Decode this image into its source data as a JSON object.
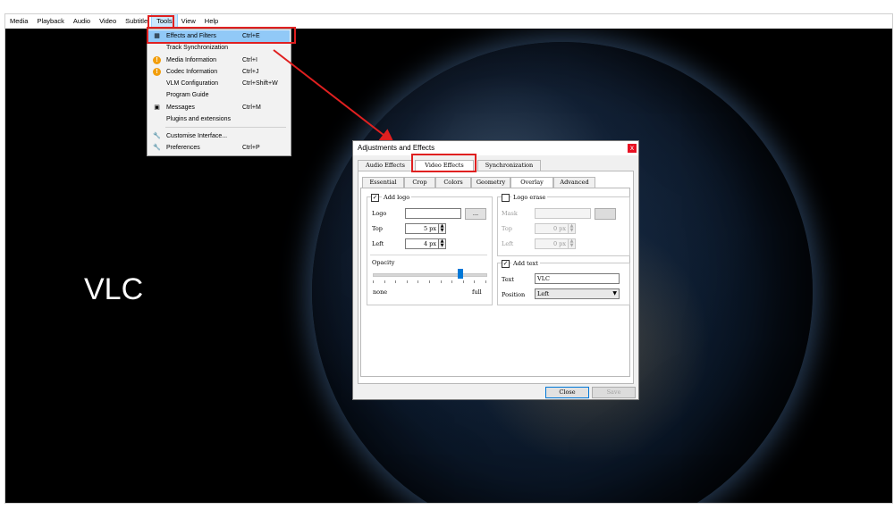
{
  "menubar": {
    "items": [
      "Media",
      "Playback",
      "Audio",
      "Video",
      "Subtitle",
      "Tools",
      "View",
      "Help"
    ],
    "active": "Tools"
  },
  "video": {
    "overlay_text": "VLC"
  },
  "tools_menu": {
    "items": [
      {
        "label": "Effects and Filters",
        "shortcut": "Ctrl+E",
        "icon": "equalizer-icon"
      },
      {
        "label": "Track Synchronization",
        "shortcut": "",
        "icon": ""
      },
      {
        "label": "Media Information",
        "shortcut": "Ctrl+I",
        "icon": "info-warning-icon"
      },
      {
        "label": "Codec Information",
        "shortcut": "Ctrl+J",
        "icon": "info-warning-icon"
      },
      {
        "label": "VLM Configuration",
        "shortcut": "Ctrl+Shift+W",
        "icon": ""
      },
      {
        "label": "Program Guide",
        "shortcut": "",
        "icon": ""
      },
      {
        "label": "Messages",
        "shortcut": "Ctrl+M",
        "icon": "messages-icon"
      },
      {
        "label": "Plugins and extensions",
        "shortcut": "",
        "icon": ""
      },
      {
        "label": "Customise Interface...",
        "shortcut": "",
        "icon": "wrench-icon"
      },
      {
        "label": "Preferences",
        "shortcut": "Ctrl+P",
        "icon": "wrench-icon"
      }
    ]
  },
  "dialog": {
    "title": "Adjustments and Effects",
    "close_glyph": "x",
    "main_tabs": [
      "Audio Effects",
      "Video Effects",
      "Synchronization"
    ],
    "sub_tabs": [
      "Essential",
      "Crop",
      "Colors",
      "Geometry",
      "Overlay",
      "Advanced"
    ],
    "logo_group": {
      "add_logo_label": "Add logo",
      "add_logo_checked": true,
      "logo_label": "Logo",
      "logo_value": "",
      "browse_label": "...",
      "top_label": "Top",
      "top_value": "5 px",
      "left_label": "Left",
      "left_value": "4 px",
      "opacity_label": "Opacity",
      "opacity_min": "none",
      "opacity_max": "full",
      "opacity_level": 0.78
    },
    "erase_group": {
      "logo_erase_label": "Logo erase",
      "logo_erase_checked": false,
      "mask_label": "Mask",
      "top_label": "Top",
      "top_value": "0 px",
      "left_label": "Left",
      "left_value": "0 px"
    },
    "text_group": {
      "add_text_label": "Add text",
      "add_text_checked": true,
      "text_label": "Text",
      "text_value": "VLC",
      "position_label": "Position",
      "position_value": "Left"
    },
    "buttons": {
      "close": "Close",
      "save": "Save"
    }
  },
  "colors": {
    "highlight_box": "#e02020",
    "menu_highlight": "#91c9f7",
    "accent": "#0078d7"
  }
}
